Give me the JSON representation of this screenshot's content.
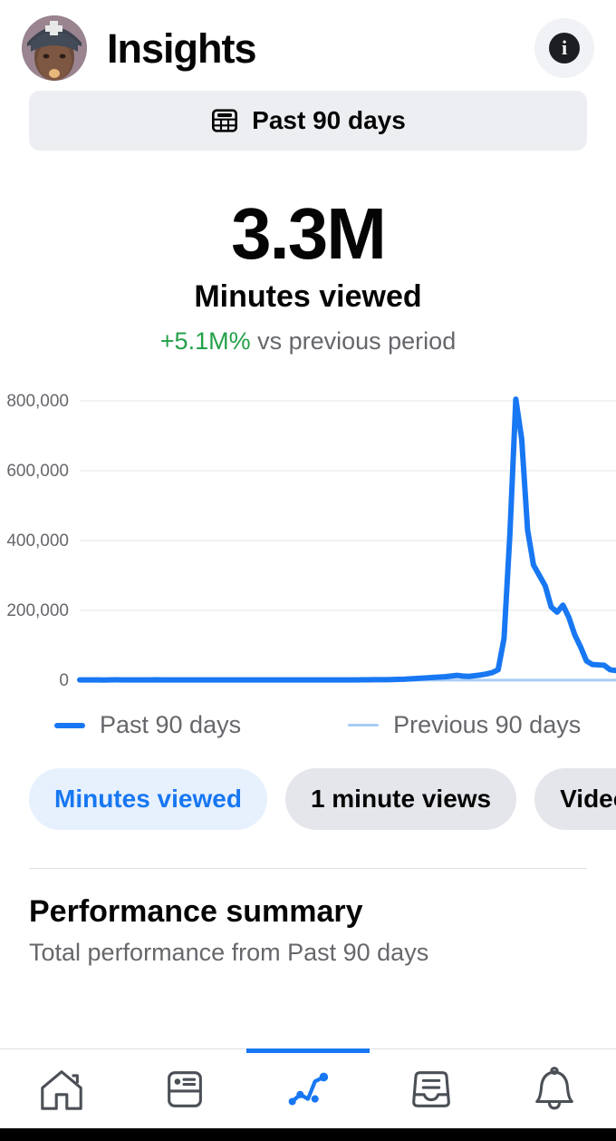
{
  "header": {
    "avatar_name": "profile-avatar",
    "title": "Insights",
    "info_label": "i"
  },
  "date_picker": {
    "label": "Past 90 days",
    "icon": "calendar-icon"
  },
  "metric": {
    "value": "3.3M",
    "label": "Minutes viewed",
    "delta": "+5.1M%",
    "delta_suffix": " vs previous period",
    "delta_color": "#24a148"
  },
  "legend": [
    {
      "label": "Past 90 days",
      "color": "#1877f2"
    },
    {
      "label": "Previous 90 days",
      "color": "#a8cdf5"
    }
  ],
  "chips": [
    {
      "label": "Minutes viewed",
      "selected": true
    },
    {
      "label": "1 minute views",
      "selected": false
    },
    {
      "label": "Video en",
      "selected": false
    }
  ],
  "performance": {
    "title": "Performance summary",
    "subtitle": "Total performance from Past 90 days"
  },
  "bottom_nav": [
    {
      "name": "home",
      "active": false
    },
    {
      "name": "pages",
      "active": false
    },
    {
      "name": "insights",
      "active": true
    },
    {
      "name": "inbox",
      "active": false
    },
    {
      "name": "notifications",
      "active": false
    }
  ],
  "chart_data": {
    "type": "line",
    "title": "Minutes viewed",
    "xlabel": "",
    "ylabel": "",
    "ylim": [
      0,
      800000
    ],
    "yticks": [
      800000,
      600000,
      400000,
      200000,
      0
    ],
    "ytick_labels": [
      "800,000",
      "600,000",
      "400,000",
      "200,000",
      "0"
    ],
    "grid": true,
    "legend_position": "below",
    "series": [
      {
        "name": "Past 90 days",
        "color": "#1877f2",
        "values": [
          1000,
          900,
          1100,
          1000,
          800,
          900,
          1200,
          1000,
          900,
          1000,
          1100,
          900,
          1000,
          1200,
          1000,
          900,
          1100,
          1000,
          900,
          1000,
          1100,
          1000,
          900,
          1000,
          1100,
          900,
          1000,
          1100,
          1000,
          900,
          1000,
          1100,
          1000,
          900,
          1100,
          1000,
          900,
          1000,
          1100,
          1000,
          900,
          1000,
          1100,
          1000,
          900,
          1000,
          1100,
          1000,
          1200,
          1400,
          1600,
          1500,
          1700,
          2000,
          2500,
          3000,
          4000,
          5000,
          6000,
          7000,
          8000,
          9000,
          10000,
          12000,
          14000,
          12000,
          11000,
          13000,
          15000,
          18000,
          22000,
          30000,
          120000,
          420000,
          805000,
          690000,
          430000,
          330000,
          300000,
          270000,
          210000,
          195000,
          215000,
          180000,
          130000,
          95000,
          55000,
          45000,
          44000,
          43000,
          30000,
          28000
        ]
      },
      {
        "name": "Previous 90 days",
        "color": "#a8cdf5",
        "values": [
          400,
          380,
          420,
          400,
          390,
          410,
          400,
          380,
          400,
          410,
          390,
          400,
          420,
          400,
          380,
          400,
          410,
          400,
          390,
          400,
          410,
          400,
          380,
          400,
          410,
          390,
          400,
          410,
          400,
          390,
          400,
          410,
          400,
          380,
          410,
          400,
          390,
          400,
          410,
          400,
          390,
          400,
          410,
          400,
          390,
          400,
          410,
          400,
          390,
          400,
          410,
          400,
          390,
          400,
          410,
          400,
          380,
          400,
          410,
          400,
          390,
          400,
          410,
          400,
          390,
          400,
          410,
          400,
          380,
          400,
          410,
          400,
          390,
          400,
          410,
          400,
          380,
          400,
          410,
          400,
          390,
          400,
          410,
          400,
          390,
          400,
          410,
          400,
          390,
          400,
          410,
          400
        ]
      }
    ]
  }
}
